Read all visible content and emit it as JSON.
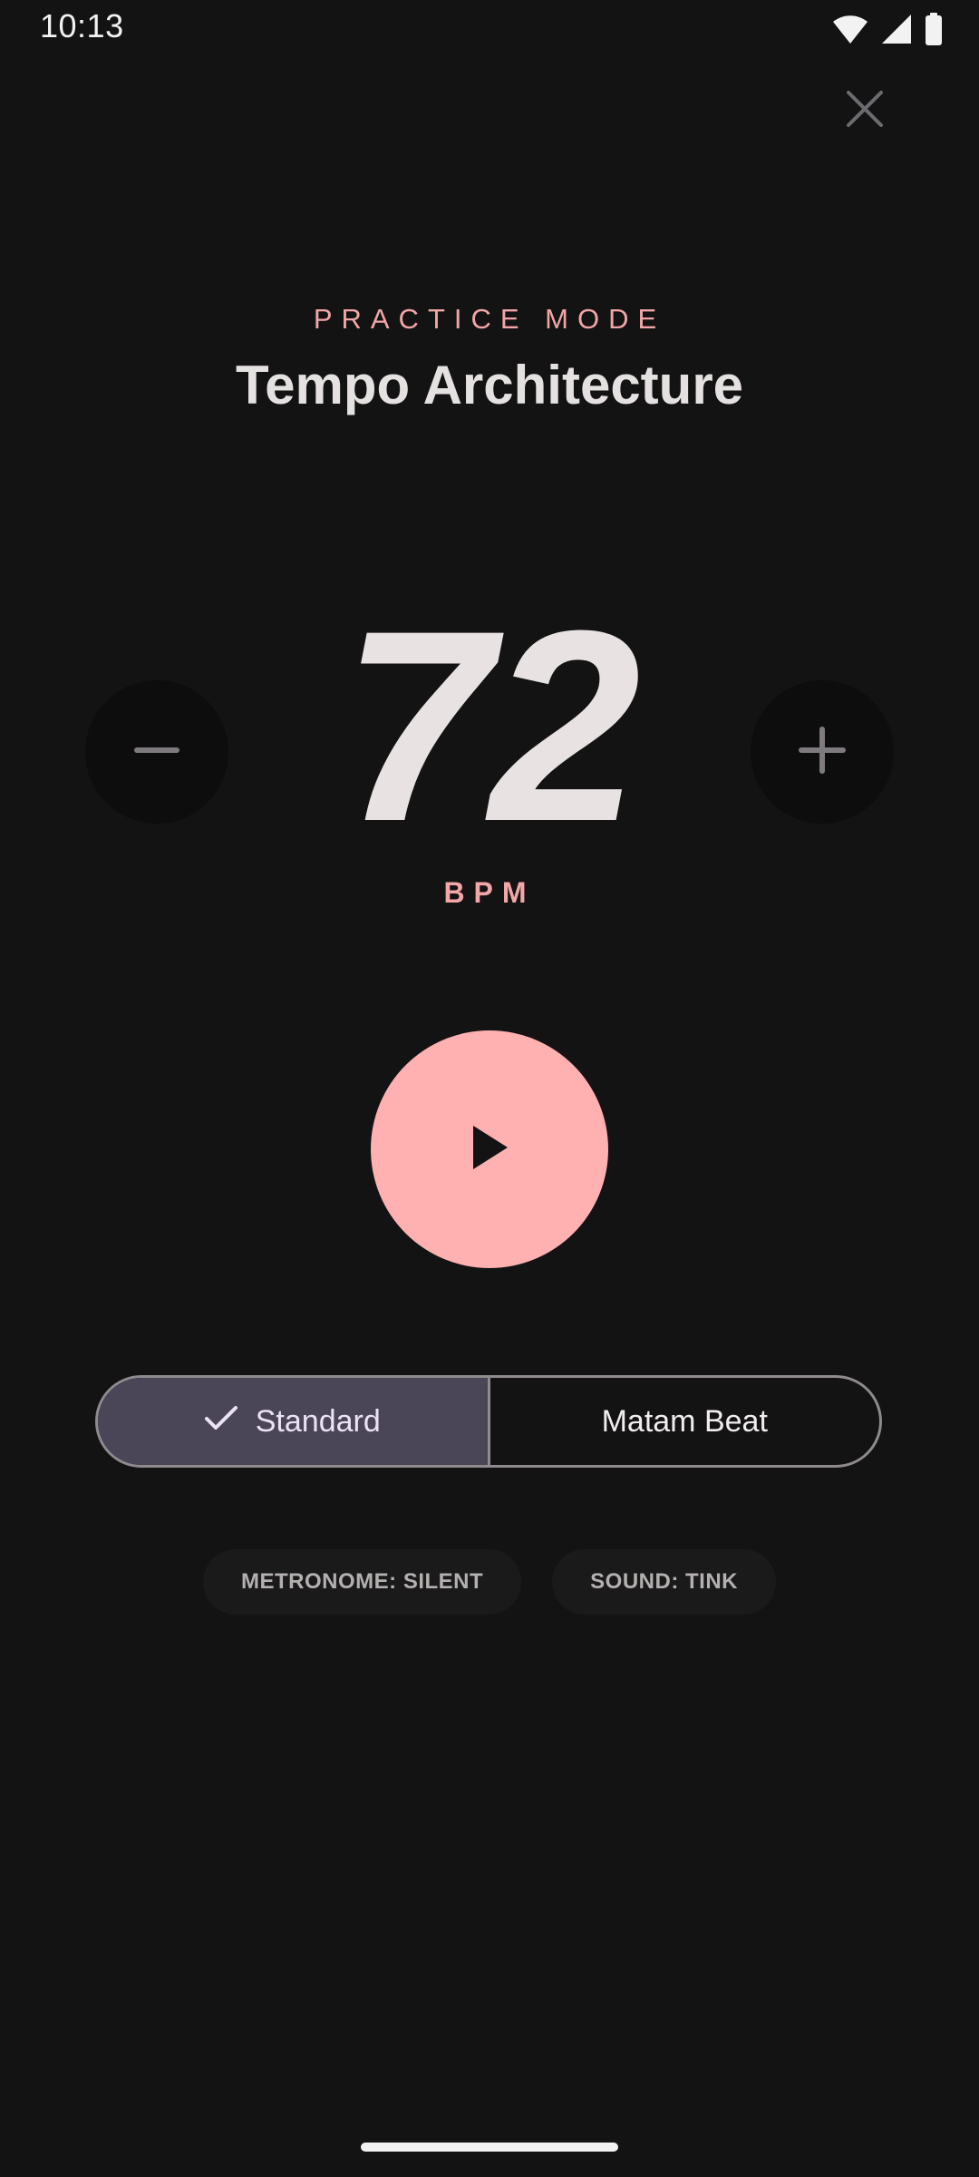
{
  "status_bar": {
    "time": "10:13",
    "icons": [
      "wifi-icon",
      "cellular-signal-icon",
      "battery-icon"
    ]
  },
  "header": {
    "close_icon": "close-icon",
    "eyebrow": "PRACTICE MODE",
    "title": "Tempo Architecture"
  },
  "tempo": {
    "value": "72",
    "unit_label": "BPM",
    "decrement_icon": "minus-icon",
    "increment_icon": "plus-icon"
  },
  "playback": {
    "play_icon": "play-icon"
  },
  "mode_selector": {
    "options": [
      {
        "label": "Standard",
        "selected": true
      },
      {
        "label": "Matam Beat",
        "selected": false
      }
    ]
  },
  "chips": [
    {
      "label": "METRONOME: SILENT"
    },
    {
      "label": "SOUND: TINK"
    }
  ],
  "colors": {
    "background": "#131313",
    "accent": "#ffb0b1",
    "accent_text": "#f2a6a8",
    "selected_segment": "#4a4557",
    "primary_text": "#e6e1e1"
  }
}
